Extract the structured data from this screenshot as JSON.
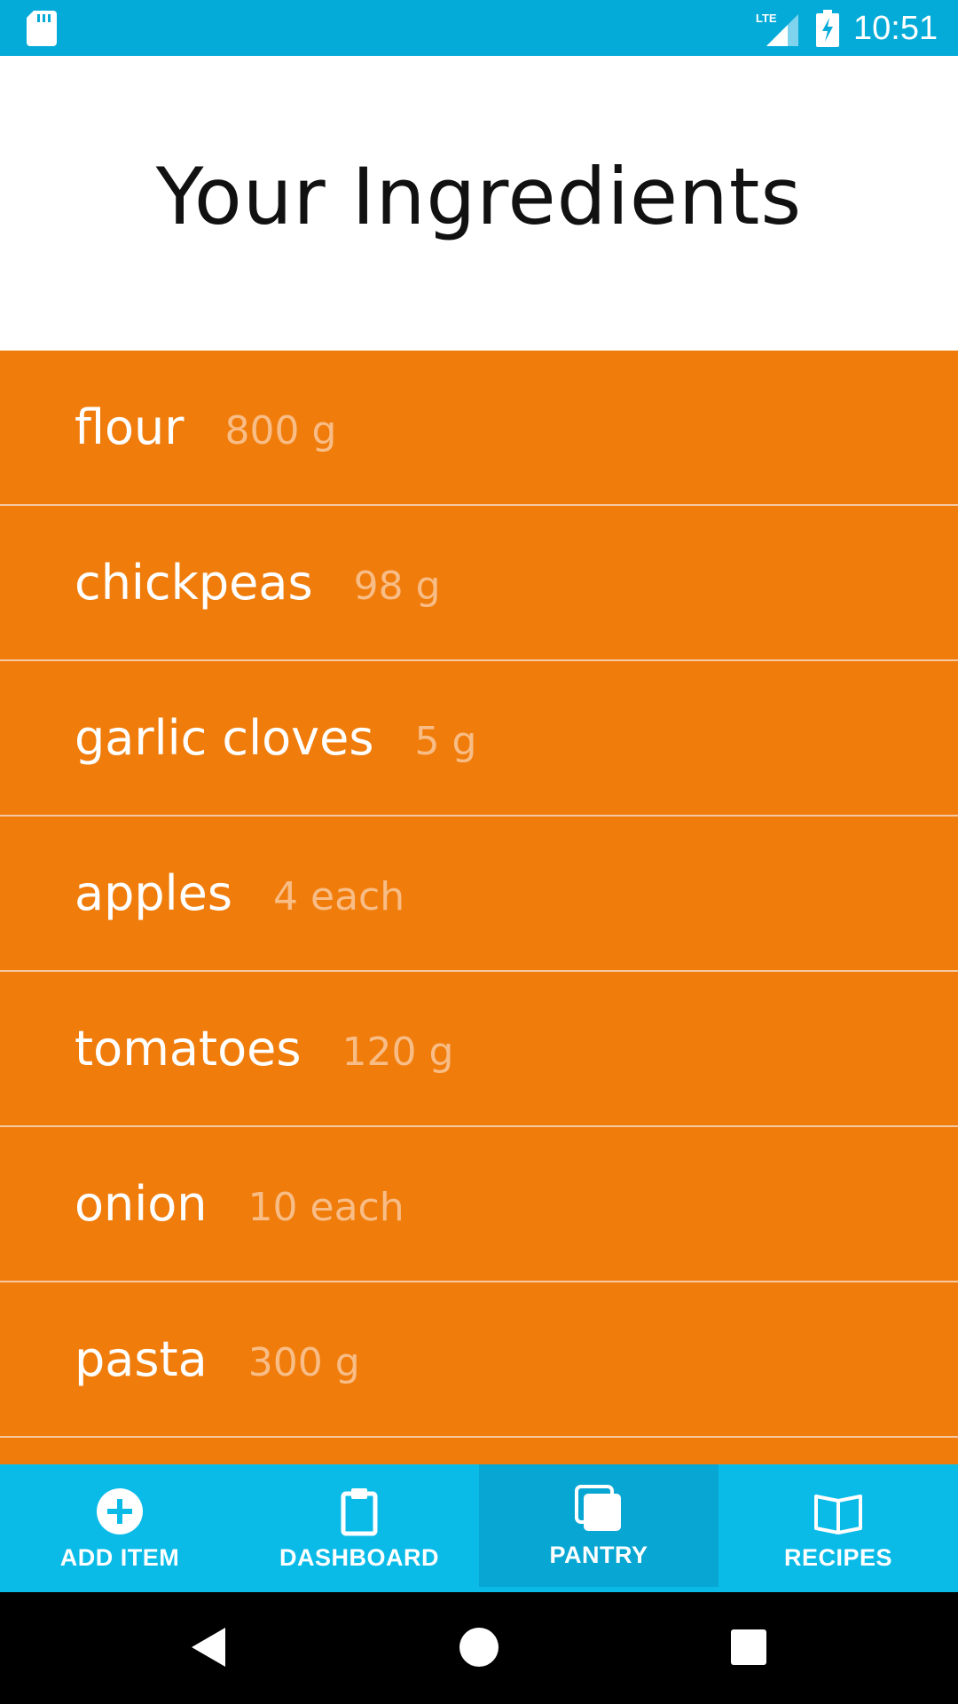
{
  "status_bar": {
    "time": "10:51",
    "icons": [
      "sd-card-icon",
      "lte-signal-icon",
      "battery-charging-icon"
    ]
  },
  "header": {
    "title": "Your Ingredients"
  },
  "ingredients": [
    {
      "name": "flour",
      "quantity": "800 g"
    },
    {
      "name": "chickpeas",
      "quantity": "98 g"
    },
    {
      "name": "garlic cloves",
      "quantity": "5 g"
    },
    {
      "name": "apples",
      "quantity": "4 each"
    },
    {
      "name": "tomatoes",
      "quantity": "120 g"
    },
    {
      "name": "onion",
      "quantity": "10 each"
    },
    {
      "name": "pasta",
      "quantity": "300 g"
    }
  ],
  "bottom_nav": {
    "items": [
      {
        "label": "ADD ITEM",
        "icon": "add-circle-icon"
      },
      {
        "label": "DASHBOARD",
        "icon": "clipboard-icon"
      },
      {
        "label": "PANTRY",
        "icon": "stacked-squares-icon",
        "active": true
      },
      {
        "label": "RECIPES",
        "icon": "open-book-icon"
      }
    ]
  },
  "system_nav": {
    "icons": [
      "back-icon",
      "home-icon",
      "recents-icon"
    ]
  },
  "colors": {
    "status_bar": "#05abd8",
    "list_background": "#f07c0b",
    "quantity_text": "#f8bd86",
    "bottom_nav": "#0abbe8",
    "bottom_nav_active": "#08a6d2"
  }
}
